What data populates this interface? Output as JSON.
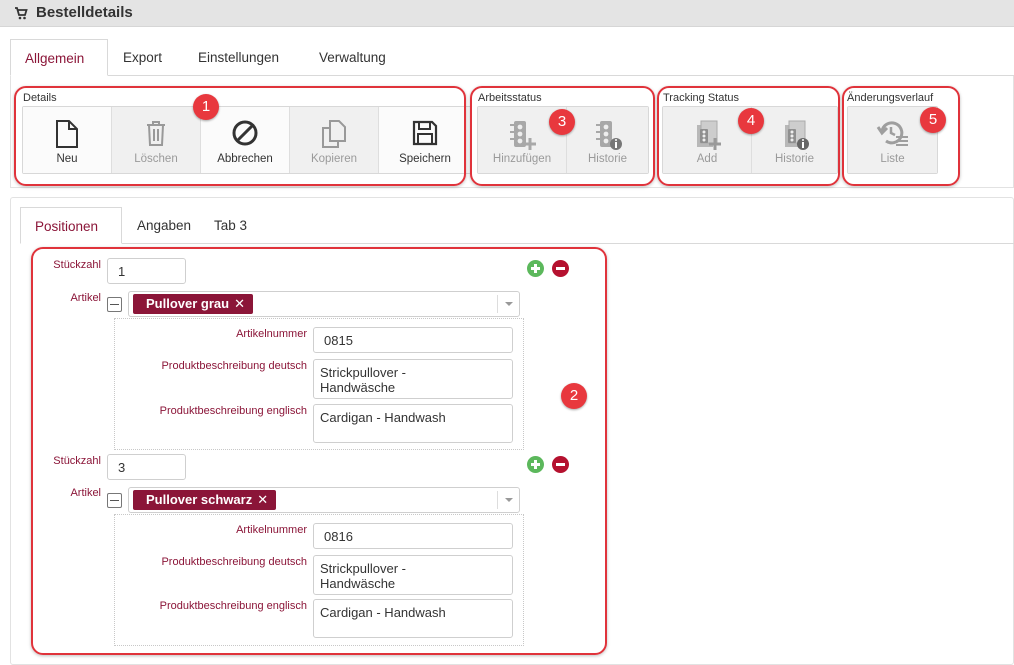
{
  "window": {
    "title": "Bestelldetails",
    "icon": "cart-icon"
  },
  "main_tabs": [
    {
      "label": "Allgemein",
      "active": true
    },
    {
      "label": "Export",
      "active": false
    },
    {
      "label": "Einstellungen",
      "active": false
    },
    {
      "label": "Verwaltung",
      "active": false
    }
  ],
  "toolbar": {
    "details": {
      "label": "Details",
      "buttons": [
        {
          "label": "Neu",
          "icon": "file-icon",
          "enabled": true
        },
        {
          "label": "Löschen",
          "icon": "trash-icon",
          "enabled": false
        },
        {
          "label": "Abbrechen",
          "icon": "cancel-icon",
          "enabled": true
        },
        {
          "label": "Kopieren",
          "icon": "copy-icon",
          "enabled": false
        },
        {
          "label": "Speichern",
          "icon": "save-icon",
          "enabled": true
        }
      ]
    },
    "arbeitsstatus": {
      "label": "Arbeitsstatus",
      "buttons": [
        {
          "label": "Hinzufügen",
          "icon": "traffic-light-add-icon",
          "enabled": false
        },
        {
          "label": "Historie",
          "icon": "traffic-light-info-icon",
          "enabled": false
        }
      ]
    },
    "tracking": {
      "label": "Tracking Status",
      "buttons": [
        {
          "label": "Add",
          "icon": "tracking-add-icon",
          "enabled": false
        },
        {
          "label": "Historie",
          "icon": "tracking-info-icon",
          "enabled": false
        }
      ]
    },
    "changelog": {
      "label": "Änderungsverlauf",
      "buttons": [
        {
          "label": "Liste",
          "icon": "history-list-icon",
          "enabled": false
        }
      ]
    }
  },
  "annotations": [
    "1",
    "2",
    "3",
    "4",
    "5"
  ],
  "sub_tabs": [
    {
      "label": "Positionen",
      "active": true
    },
    {
      "label": "Angaben",
      "active": false
    },
    {
      "label": "Tab 3",
      "active": false
    }
  ],
  "positions_labels": {
    "quantity": "Stückzahl",
    "article": "Artikel",
    "article_number": "Artikelnummer",
    "desc_de": "Produktbeschreibung deutsch",
    "desc_en": "Produktbeschreibung englisch"
  },
  "positions": [
    {
      "quantity": "1",
      "article": "Pullover grau",
      "article_remove": "✕",
      "article_number": "0815",
      "desc_de": "Strickpullover -\nHandwäsche",
      "desc_en": "Cardigan - Handwash"
    },
    {
      "quantity": "3",
      "article": "Pullover schwarz",
      "article_remove": "✕",
      "article_number": "0816",
      "desc_de": "Strickpullover -\nHandwäsche",
      "desc_en": "Cardigan - Handwash"
    }
  ],
  "colors": {
    "accent": "#8b1538",
    "annotation_red": "#e8383e",
    "add_green": "#5cb85c",
    "remove_red": "#b5112f"
  }
}
